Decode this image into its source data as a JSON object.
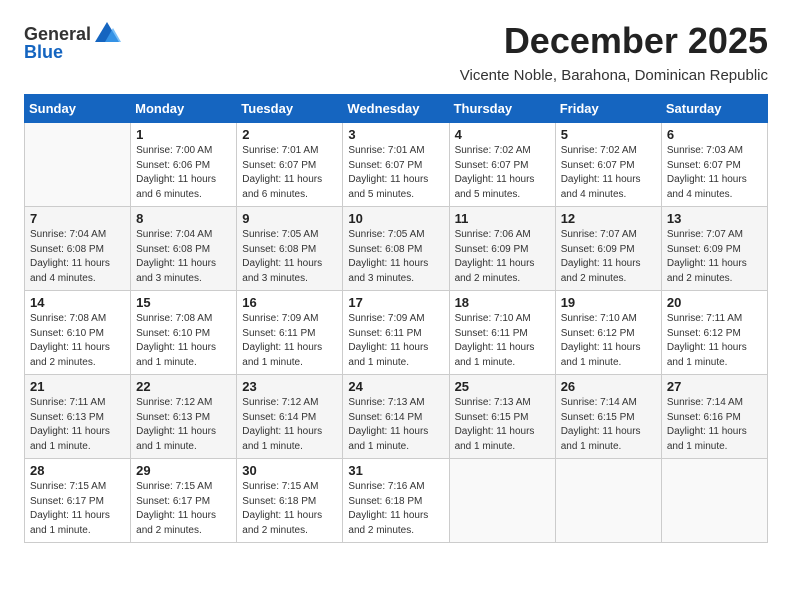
{
  "header": {
    "logo_general": "General",
    "logo_blue": "Blue",
    "month_title": "December 2025",
    "subtitle": "Vicente Noble, Barahona, Dominican Republic"
  },
  "weekdays": [
    "Sunday",
    "Monday",
    "Tuesday",
    "Wednesday",
    "Thursday",
    "Friday",
    "Saturday"
  ],
  "weeks": [
    [
      {
        "day": "",
        "sunrise": "",
        "sunset": "",
        "daylight": "",
        "empty": true
      },
      {
        "day": "1",
        "sunrise": "Sunrise: 7:00 AM",
        "sunset": "Sunset: 6:06 PM",
        "daylight": "Daylight: 11 hours and 6 minutes."
      },
      {
        "day": "2",
        "sunrise": "Sunrise: 7:01 AM",
        "sunset": "Sunset: 6:07 PM",
        "daylight": "Daylight: 11 hours and 6 minutes."
      },
      {
        "day": "3",
        "sunrise": "Sunrise: 7:01 AM",
        "sunset": "Sunset: 6:07 PM",
        "daylight": "Daylight: 11 hours and 5 minutes."
      },
      {
        "day": "4",
        "sunrise": "Sunrise: 7:02 AM",
        "sunset": "Sunset: 6:07 PM",
        "daylight": "Daylight: 11 hours and 5 minutes."
      },
      {
        "day": "5",
        "sunrise": "Sunrise: 7:02 AM",
        "sunset": "Sunset: 6:07 PM",
        "daylight": "Daylight: 11 hours and 4 minutes."
      },
      {
        "day": "6",
        "sunrise": "Sunrise: 7:03 AM",
        "sunset": "Sunset: 6:07 PM",
        "daylight": "Daylight: 11 hours and 4 minutes."
      }
    ],
    [
      {
        "day": "7",
        "sunrise": "Sunrise: 7:04 AM",
        "sunset": "Sunset: 6:08 PM",
        "daylight": "Daylight: 11 hours and 4 minutes."
      },
      {
        "day": "8",
        "sunrise": "Sunrise: 7:04 AM",
        "sunset": "Sunset: 6:08 PM",
        "daylight": "Daylight: 11 hours and 3 minutes."
      },
      {
        "day": "9",
        "sunrise": "Sunrise: 7:05 AM",
        "sunset": "Sunset: 6:08 PM",
        "daylight": "Daylight: 11 hours and 3 minutes."
      },
      {
        "day": "10",
        "sunrise": "Sunrise: 7:05 AM",
        "sunset": "Sunset: 6:08 PM",
        "daylight": "Daylight: 11 hours and 3 minutes."
      },
      {
        "day": "11",
        "sunrise": "Sunrise: 7:06 AM",
        "sunset": "Sunset: 6:09 PM",
        "daylight": "Daylight: 11 hours and 2 minutes."
      },
      {
        "day": "12",
        "sunrise": "Sunrise: 7:07 AM",
        "sunset": "Sunset: 6:09 PM",
        "daylight": "Daylight: 11 hours and 2 minutes."
      },
      {
        "day": "13",
        "sunrise": "Sunrise: 7:07 AM",
        "sunset": "Sunset: 6:09 PM",
        "daylight": "Daylight: 11 hours and 2 minutes."
      }
    ],
    [
      {
        "day": "14",
        "sunrise": "Sunrise: 7:08 AM",
        "sunset": "Sunset: 6:10 PM",
        "daylight": "Daylight: 11 hours and 2 minutes."
      },
      {
        "day": "15",
        "sunrise": "Sunrise: 7:08 AM",
        "sunset": "Sunset: 6:10 PM",
        "daylight": "Daylight: 11 hours and 1 minute."
      },
      {
        "day": "16",
        "sunrise": "Sunrise: 7:09 AM",
        "sunset": "Sunset: 6:11 PM",
        "daylight": "Daylight: 11 hours and 1 minute."
      },
      {
        "day": "17",
        "sunrise": "Sunrise: 7:09 AM",
        "sunset": "Sunset: 6:11 PM",
        "daylight": "Daylight: 11 hours and 1 minute."
      },
      {
        "day": "18",
        "sunrise": "Sunrise: 7:10 AM",
        "sunset": "Sunset: 6:11 PM",
        "daylight": "Daylight: 11 hours and 1 minute."
      },
      {
        "day": "19",
        "sunrise": "Sunrise: 7:10 AM",
        "sunset": "Sunset: 6:12 PM",
        "daylight": "Daylight: 11 hours and 1 minute."
      },
      {
        "day": "20",
        "sunrise": "Sunrise: 7:11 AM",
        "sunset": "Sunset: 6:12 PM",
        "daylight": "Daylight: 11 hours and 1 minute."
      }
    ],
    [
      {
        "day": "21",
        "sunrise": "Sunrise: 7:11 AM",
        "sunset": "Sunset: 6:13 PM",
        "daylight": "Daylight: 11 hours and 1 minute."
      },
      {
        "day": "22",
        "sunrise": "Sunrise: 7:12 AM",
        "sunset": "Sunset: 6:13 PM",
        "daylight": "Daylight: 11 hours and 1 minute."
      },
      {
        "day": "23",
        "sunrise": "Sunrise: 7:12 AM",
        "sunset": "Sunset: 6:14 PM",
        "daylight": "Daylight: 11 hours and 1 minute."
      },
      {
        "day": "24",
        "sunrise": "Sunrise: 7:13 AM",
        "sunset": "Sunset: 6:14 PM",
        "daylight": "Daylight: 11 hours and 1 minute."
      },
      {
        "day": "25",
        "sunrise": "Sunrise: 7:13 AM",
        "sunset": "Sunset: 6:15 PM",
        "daylight": "Daylight: 11 hours and 1 minute."
      },
      {
        "day": "26",
        "sunrise": "Sunrise: 7:14 AM",
        "sunset": "Sunset: 6:15 PM",
        "daylight": "Daylight: 11 hours and 1 minute."
      },
      {
        "day": "27",
        "sunrise": "Sunrise: 7:14 AM",
        "sunset": "Sunset: 6:16 PM",
        "daylight": "Daylight: 11 hours and 1 minute."
      }
    ],
    [
      {
        "day": "28",
        "sunrise": "Sunrise: 7:15 AM",
        "sunset": "Sunset: 6:17 PM",
        "daylight": "Daylight: 11 hours and 1 minute."
      },
      {
        "day": "29",
        "sunrise": "Sunrise: 7:15 AM",
        "sunset": "Sunset: 6:17 PM",
        "daylight": "Daylight: 11 hours and 2 minutes."
      },
      {
        "day": "30",
        "sunrise": "Sunrise: 7:15 AM",
        "sunset": "Sunset: 6:18 PM",
        "daylight": "Daylight: 11 hours and 2 minutes."
      },
      {
        "day": "31",
        "sunrise": "Sunrise: 7:16 AM",
        "sunset": "Sunset: 6:18 PM",
        "daylight": "Daylight: 11 hours and 2 minutes."
      },
      {
        "day": "",
        "sunrise": "",
        "sunset": "",
        "daylight": "",
        "empty": true
      },
      {
        "day": "",
        "sunrise": "",
        "sunset": "",
        "daylight": "",
        "empty": true
      },
      {
        "day": "",
        "sunrise": "",
        "sunset": "",
        "daylight": "",
        "empty": true
      }
    ]
  ]
}
